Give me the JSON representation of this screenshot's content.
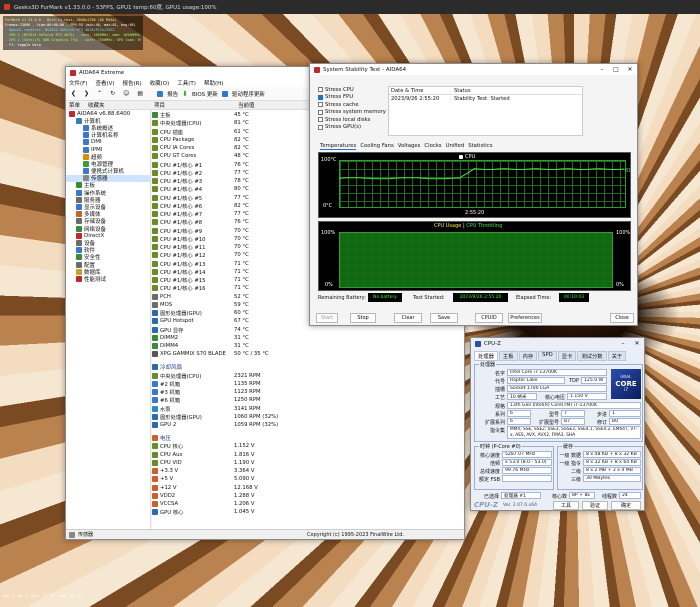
{
  "furmark": {
    "title": "Geeks3D FurMark v1.33.0.0 - 53FPS, GPU1 temp:60度, GPU1 usage:100%",
    "info_lines": [
      "FurMark v1.33.0.0 - Burn-in test, 3840x1760 (0X MSAA)",
      "Frames:23096 - time:06:00:00 - FPS:53 (min:46, max:81, avg:58)",
      "- OpenGL renderer: NVIDIA GeForce RTX 4070/PCIe/SSE2",
      "- GPU 1 (NVIDIA GeForce RTX 4070) - core: 2805MHz, mem: 10500MHz, GPU load: 100%, GPU temp: 60°C",
      "- GPU 2 (Intel(R) UHD Graphics 770) - core: 1550MHz, GPU load: 0%",
      "- F1: toggle help"
    ],
    "footer": "GPU 1: 60 °C (min: 35 °C - max: 61 °C)"
  },
  "aida": {
    "title": "AIDA64 Extreme",
    "menu": [
      "文件(F)",
      "查看(V)",
      "报告(R)",
      "收藏(O)",
      "工具(T)",
      "帮助(H)"
    ],
    "toolbar": {
      "report": "报告",
      "bios": "BIOS 更新",
      "driver": "驱动程序更新"
    },
    "col_left_1": "菜单",
    "col_left_2": "收藏夹",
    "col_item": "项目",
    "col_value": "当前值",
    "tree": [
      {
        "label": "AIDA64 v6.88.6400",
        "icon": "aida-logo-icon",
        "color": "#c0282d",
        "indent": 0,
        "sel": false
      },
      {
        "label": "计算机",
        "icon": "computer-icon",
        "color": "#3a78c9",
        "indent": 1,
        "sel": false
      },
      {
        "label": "系统概述",
        "icon": "summary-icon",
        "color": "#3a78c9",
        "indent": 2,
        "sel": false
      },
      {
        "label": "计算机名称",
        "icon": "computer-name-icon",
        "color": "#3a78c9",
        "indent": 2,
        "sel": false
      },
      {
        "label": "DMI",
        "icon": "dmi-icon",
        "color": "#3a78c9",
        "indent": 2,
        "sel": false
      },
      {
        "label": "IPMI",
        "icon": "ipmi-icon",
        "color": "#3a78c9",
        "indent": 2,
        "sel": false
      },
      {
        "label": "超频",
        "icon": "overclock-icon",
        "color": "#e08a00",
        "indent": 2,
        "sel": false
      },
      {
        "label": "电源管理",
        "icon": "power-icon",
        "color": "#3aa13a",
        "indent": 2,
        "sel": false
      },
      {
        "label": "便携式计算机",
        "icon": "laptop-icon",
        "color": "#3a78c9",
        "indent": 2,
        "sel": false
      },
      {
        "label": "传感器",
        "icon": "sensor-icon",
        "color": "#888888",
        "indent": 2,
        "sel": true
      },
      {
        "label": "主板",
        "icon": "motherboard-icon",
        "color": "#3a8a3a",
        "indent": 1,
        "sel": false
      },
      {
        "label": "操作系统",
        "icon": "os-icon",
        "color": "#3a78c9",
        "indent": 1,
        "sel": false
      },
      {
        "label": "服务器",
        "icon": "server-icon",
        "color": "#6b6b6b",
        "indent": 1,
        "sel": false
      },
      {
        "label": "显示设备",
        "icon": "display-icon",
        "color": "#3a78c9",
        "indent": 1,
        "sel": false
      },
      {
        "label": "多媒体",
        "icon": "multimedia-icon",
        "color": "#c9622a",
        "indent": 1,
        "sel": false
      },
      {
        "label": "存储设备",
        "icon": "storage-icon",
        "color": "#6b6b6b",
        "indent": 1,
        "sel": false
      },
      {
        "label": "网络设备",
        "icon": "network-icon",
        "color": "#3a8a3a",
        "indent": 1,
        "sel": false
      },
      {
        "label": "DirectX",
        "icon": "directx-icon",
        "color": "#c0282d",
        "indent": 1,
        "sel": false
      },
      {
        "label": "设备",
        "icon": "devices-icon",
        "color": "#6b6b6b",
        "indent": 1,
        "sel": false
      },
      {
        "label": "软件",
        "icon": "software-icon",
        "color": "#3a78c9",
        "indent": 1,
        "sel": false
      },
      {
        "label": "安全性",
        "icon": "security-icon",
        "color": "#3a8a3a",
        "indent": 1,
        "sel": false
      },
      {
        "label": "配置",
        "icon": "config-icon",
        "color": "#6b6b6b",
        "indent": 1,
        "sel": false
      },
      {
        "label": "数据库",
        "icon": "database-icon",
        "color": "#c9a02a",
        "indent": 1,
        "sel": false
      },
      {
        "label": "性能测试",
        "icon": "benchmark-icon",
        "color": "#c0282d",
        "indent": 1,
        "sel": false
      }
    ],
    "temps": [
      {
        "name": "主板",
        "value": "45 °C",
        "icon": "motherboard-icon"
      },
      {
        "name": "中央处理器(CPU)",
        "value": "81 °C",
        "icon": "cpu-icon"
      },
      {
        "name": "CPU 插座",
        "value": "61 °C",
        "icon": "cpu-icon"
      },
      {
        "name": "CPU Package",
        "value": "82 °C",
        "icon": "cpu-icon"
      },
      {
        "name": "CPU IA Cores",
        "value": "82 °C",
        "icon": "cpu-icon"
      },
      {
        "name": "CPU GT Cores",
        "value": "48 °C",
        "icon": "cpu-icon"
      },
      {
        "name": "CPU #1/核心 #1",
        "value": "76 °C",
        "icon": "cpu-icon"
      },
      {
        "name": "CPU #1/核心 #2",
        "value": "77 °C",
        "icon": "cpu-icon"
      },
      {
        "name": "CPU #1/核心 #3",
        "value": "78 °C",
        "icon": "cpu-icon"
      },
      {
        "name": "CPU #1/核心 #4",
        "value": "80 °C",
        "icon": "cpu-icon"
      },
      {
        "name": "CPU #1/核心 #5",
        "value": "77 °C",
        "icon": "cpu-icon"
      },
      {
        "name": "CPU #1/核心 #6",
        "value": "82 °C",
        "icon": "cpu-icon"
      },
      {
        "name": "CPU #1/核心 #7",
        "value": "77 °C",
        "icon": "cpu-icon"
      },
      {
        "name": "CPU #1/核心 #8",
        "value": "76 °C",
        "icon": "cpu-icon"
      },
      {
        "name": "CPU #1/核心 #9",
        "value": "70 °C",
        "icon": "cpu-icon"
      },
      {
        "name": "CPU #1/核心 #10",
        "value": "70 °C",
        "icon": "cpu-icon"
      },
      {
        "name": "CPU #1/核心 #11",
        "value": "70 °C",
        "icon": "cpu-icon"
      },
      {
        "name": "CPU #1/核心 #12",
        "value": "70 °C",
        "icon": "cpu-icon"
      },
      {
        "name": "CPU #1/核心 #13",
        "value": "71 °C",
        "icon": "cpu-icon"
      },
      {
        "name": "CPU #1/核心 #14",
        "value": "71 °C",
        "icon": "cpu-icon"
      },
      {
        "name": "CPU #1/核心 #15",
        "value": "71 °C",
        "icon": "cpu-icon"
      },
      {
        "name": "CPU #1/核心 #16",
        "value": "71 °C",
        "icon": "cpu-icon"
      },
      {
        "name": "PCH",
        "value": "52 °C",
        "icon": "chip-icon"
      },
      {
        "name": "MOS",
        "value": "59 °C",
        "icon": "chip-icon"
      },
      {
        "name": "图形处理器(GPU)",
        "value": "60 °C",
        "icon": "gpu-icon"
      },
      {
        "name": "GPU Hotspot",
        "value": "67 °C",
        "icon": "gpu-icon"
      },
      {
        "name": "GPU 显存",
        "value": "74 °C",
        "icon": "gpu-icon"
      },
      {
        "name": "DIMM2",
        "value": "31 °C",
        "icon": "memory-icon"
      },
      {
        "name": "DIMM4",
        "value": "31 °C",
        "icon": "memory-icon"
      },
      {
        "name": "XPG GAMMIX S70 BLADE",
        "value": "50 °C / 35 °C",
        "icon": "ssd-icon"
      }
    ],
    "fans_title": "冷却风扇",
    "fans": [
      {
        "name": "中央处理器(CPU)",
        "value": "2321 RPM",
        "icon": "cpu-icon"
      },
      {
        "name": "#2 机箱",
        "value": "1135 RPM",
        "icon": "fan-icon"
      },
      {
        "name": "#3 机箱",
        "value": "1123 RPM",
        "icon": "fan-icon"
      },
      {
        "name": "#6 机箱",
        "value": "1250 RPM",
        "icon": "fan-icon"
      },
      {
        "name": "水泵",
        "value": "3141 RPM",
        "icon": "pump-icon"
      },
      {
        "name": "图形处理器(GPU)",
        "value": "1060 RPM  (32%)",
        "icon": "gpu-icon"
      },
      {
        "name": "GPU 2",
        "value": "1059 RPM  (32%)",
        "icon": "gpu-icon"
      }
    ],
    "volt_title": "电压",
    "volts": [
      {
        "name": "CPU 核心",
        "value": "1.152 V",
        "icon": "cpu-icon"
      },
      {
        "name": "CPU Aux",
        "value": "1.816 V",
        "icon": "cpu-icon"
      },
      {
        "name": "CPU VID",
        "value": "1.190 V",
        "icon": "cpu-icon"
      },
      {
        "name": "+3.3 V",
        "value": "3.364 V",
        "icon": "voltage-icon"
      },
      {
        "name": "+5 V",
        "value": "5.090 V",
        "icon": "voltage-icon"
      },
      {
        "name": "+12 V",
        "value": "12.168 V",
        "icon": "voltage-icon"
      },
      {
        "name": "VDD2",
        "value": "1.288 V",
        "icon": "voltage-icon"
      },
      {
        "name": "VCCSA",
        "value": "1.206 V",
        "icon": "voltage-icon"
      },
      {
        "name": "GPU 核心",
        "value": "1.045 V",
        "icon": "gpu-icon"
      }
    ],
    "status_left": "传感器",
    "status_right": "Copyright (c) 1995-2023 FinalWire Ltd."
  },
  "sst": {
    "title": "System Stability Test - AIDA64",
    "checks": [
      {
        "label": "Stress CPU",
        "checked": false
      },
      {
        "label": "Stress FPU",
        "checked": true
      },
      {
        "label": "Stress cache",
        "checked": false
      },
      {
        "label": "Stress system memory",
        "checked": false
      },
      {
        "label": "Stress local disks",
        "checked": false
      },
      {
        "label": "Stress GPU(s)",
        "checked": false
      }
    ],
    "log_head_date": "Date & Time",
    "log_head_status": "Status",
    "log_date": "2023/9/26 2:55:20",
    "log_status": "Stability Test: Started",
    "tabs": [
      "Temperatures",
      "Cooling Fans",
      "Voltages",
      "Clocks",
      "Unified",
      "Statistics"
    ],
    "temp_graph": {
      "legend": "CPU",
      "top": "100°C",
      "bottom": "0°C",
      "time": "2:55:20",
      "value": "81"
    },
    "usage_graph": {
      "legend_a": "CPU Usage",
      "legend_sep": "|",
      "legend_b": "CPU Throttling",
      "top_left": "100%",
      "top_right": "100%",
      "bottom_left": "0%",
      "bottom_right": "0%"
    },
    "remaining_label": "Remaining Battery:",
    "remaining_value": "No battery",
    "started_label": "Test Started:",
    "started_value": "2023/9/26 2:55:20",
    "elapsed_label": "Elapsed Time:",
    "elapsed_value": "00:10:03",
    "buttons": {
      "start": "Start",
      "stop": "Stop",
      "clear": "Clear",
      "save": "Save",
      "cpuid": "CPUID",
      "prefs": "Preferences",
      "close": "Close"
    }
  },
  "cpuz": {
    "title": "CPU-Z",
    "tabs": [
      "处理器",
      "主板",
      "内存",
      "SPD",
      "显卡",
      "测试分数",
      "关于"
    ],
    "proc_legend": "处理器",
    "name_lab": "名字",
    "name_val": "Intel Core i7 13700K",
    "code_lab": "代号",
    "code_val": "Raptor Lake",
    "tdp_lab": "TDP",
    "tdp_val": "125.0 W",
    "pkg_lab": "插槽",
    "pkg_val": "Socket 1700 LGA",
    "tech_lab": "工艺",
    "tech_val": "10 纳米",
    "vcore_lab": "核心电压",
    "vcore_val": "1.150 V",
    "spec_lab": "规格",
    "spec_val": "13th Gen Intel(R) Core(TM) i7-13700K",
    "fam_lab": "系列",
    "fam_val": "6",
    "model_lab": "型号",
    "model_val": "7",
    "step_lab": "步进",
    "step_val": "1",
    "extfam_lab": "扩展系列",
    "extfam_val": "6",
    "extmod_lab": "扩展型号",
    "extmod_val": "B7",
    "rev_lab": "修订",
    "rev_val": "B0",
    "instr_lab": "指令集",
    "instr_val": "MMX, SSE, SSE2, SSE3, SSSE3, SSE4.1, SSE4.2, EM64T, VT-x, AES, AVX, AVX2, FMA3, SHA",
    "clock_legend": "时钟 (P-Core #0)",
    "cs_lab": "核心速度",
    "cs_val": "5287.07 MHz",
    "mult_lab": "倍频",
    "mult_val": "x 53.0 (8.0 - 53.0)",
    "bus_lab": "总线速度",
    "bus_val": "99.76 MHz",
    "fsb_lab": "额定 FSB",
    "fsb_val": "",
    "cache_legend": "缓存",
    "l1d_lab": "一级 数据",
    "l1d_val": "8 x 48 KB + 8 x 32 KB",
    "l1i_lab": "一级 指令",
    "l1i_val": "8 x 32 KB + 8 x 64 KB",
    "l2_lab": "二级",
    "l2_val": "8 x 2 MB + 2 x 4 MB",
    "l3_lab": "三级",
    "l3_val": "30 MBytes",
    "sel_lab": "已选择",
    "sel_val": "处理器 #1",
    "cores_lab": "核心数",
    "cores_val": "8P + 8E",
    "threads_lab": "线程数",
    "threads_val": "24",
    "brand": "CPU-Z",
    "version": "Ver. 2.07.0.x64",
    "btn_tools": "工具",
    "btn_verify": "验证",
    "btn_ok": "确定",
    "logo_line1": "intel.",
    "logo_line2": "CORE",
    "logo_line3": "i7"
  }
}
